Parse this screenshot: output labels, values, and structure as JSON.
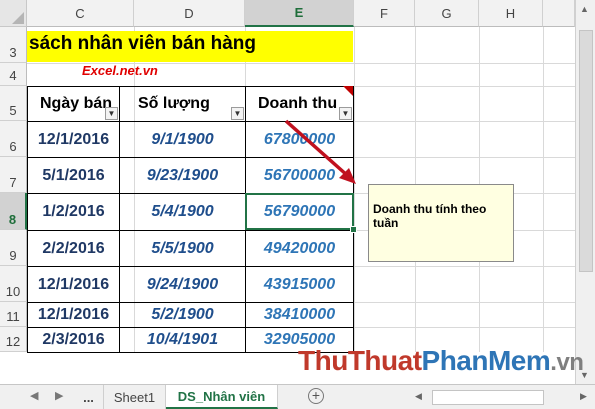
{
  "columns": [
    {
      "label": "C",
      "selected": false
    },
    {
      "label": "D",
      "selected": false
    },
    {
      "label": "E",
      "selected": true
    },
    {
      "label": "F",
      "selected": false
    },
    {
      "label": "G",
      "selected": false
    },
    {
      "label": "H",
      "selected": false
    }
  ],
  "rows": [
    {
      "label": "3",
      "selected": false
    },
    {
      "label": "4",
      "selected": false
    },
    {
      "label": "5",
      "selected": false
    },
    {
      "label": "6",
      "selected": false
    },
    {
      "label": "7",
      "selected": false
    },
    {
      "label": "8",
      "selected": true
    },
    {
      "label": "9",
      "selected": false
    },
    {
      "label": "10",
      "selected": false
    },
    {
      "label": "11",
      "selected": false
    },
    {
      "label": "12",
      "selected": false
    }
  ],
  "sheet": {
    "title": "sách nhân viên bán hàng",
    "brand": "Excel.net.vn",
    "headers": [
      "Ngày bán",
      "Số lượng",
      "Doanh thu"
    ],
    "records": [
      {
        "date": "12/1/2016",
        "qty": "9/1/1900",
        "revenue": "67800000"
      },
      {
        "date": "5/1/2016",
        "qty": "9/23/1900",
        "revenue": "56700000"
      },
      {
        "date": "1/2/2016",
        "qty": "5/4/1900",
        "revenue": "56790000"
      },
      {
        "date": "2/2/2016",
        "qty": "5/5/1900",
        "revenue": "49420000"
      },
      {
        "date": "12/1/2016",
        "qty": "9/24/1900",
        "revenue": "43915000"
      },
      {
        "date": "12/1/2016",
        "qty": "5/2/1900",
        "revenue": "38410000"
      },
      {
        "date": "2/3/2016",
        "qty": "10/4/1901",
        "revenue": "32905000"
      }
    ],
    "comment": "Doanh thu tính theo tuần"
  },
  "tabs": {
    "ellipsis": "...",
    "sheet1": "Sheet1",
    "active": "DS_Nhân viên",
    "add": "+"
  },
  "watermark": {
    "part1": "Thu",
    "part2": "Thuat",
    "part3": "PhanMem",
    "part4": ".vn"
  },
  "colors": {
    "accent": "#217346",
    "title_fill": "#ffff00",
    "brand": "#e00000",
    "arrow": "#c0111f"
  }
}
